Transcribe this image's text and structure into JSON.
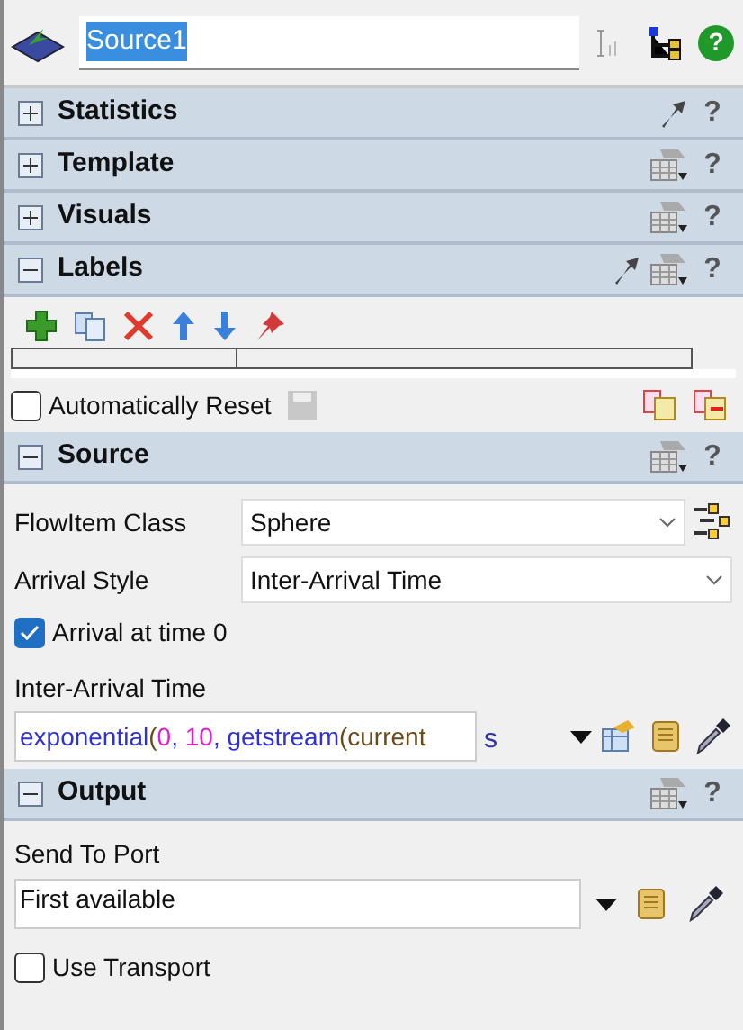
{
  "header": {
    "name_value": "Source1",
    "help": "?"
  },
  "sections": [
    {
      "kind": "statistics",
      "title": "Statistics",
      "expanded": false,
      "help": "?"
    },
    {
      "kind": "template",
      "title": "Template",
      "expanded": false,
      "help": "?"
    },
    {
      "kind": "visuals",
      "title": "Visuals",
      "expanded": false,
      "help": "?"
    },
    {
      "kind": "labels",
      "title": "Labels",
      "expanded": true,
      "help": "?",
      "auto_reset": {
        "label": "Automatically Reset",
        "checked": false
      }
    },
    {
      "kind": "source",
      "title": "Source",
      "expanded": true,
      "help": "?",
      "flowitem_class": {
        "label": "FlowItem Class",
        "value": "Sphere"
      },
      "arrival_style": {
        "label": "Arrival Style",
        "value": "Inter-Arrival Time"
      },
      "arrival_at_time_0": {
        "label": "Arrival at time 0",
        "checked": true
      },
      "inter_arrival_time": {
        "label": "Inter-Arrival Time",
        "unit": "s",
        "code": [
          {
            "kind": "ident",
            "text": "exponential"
          },
          {
            "kind": "paren",
            "text": "("
          },
          {
            "kind": "num",
            "text": "0"
          },
          {
            "kind": "ident",
            "text": ", "
          },
          {
            "kind": "num",
            "text": "10"
          },
          {
            "kind": "ident",
            "text": ", getstream"
          },
          {
            "kind": "paren",
            "text": "(current"
          }
        ]
      }
    },
    {
      "kind": "output",
      "title": "Output",
      "expanded": true,
      "help": "?",
      "send_to_port": {
        "label": "Send To Port",
        "value": "First available"
      },
      "use_transport": {
        "label": "Use Transport",
        "checked": false
      }
    }
  ]
}
